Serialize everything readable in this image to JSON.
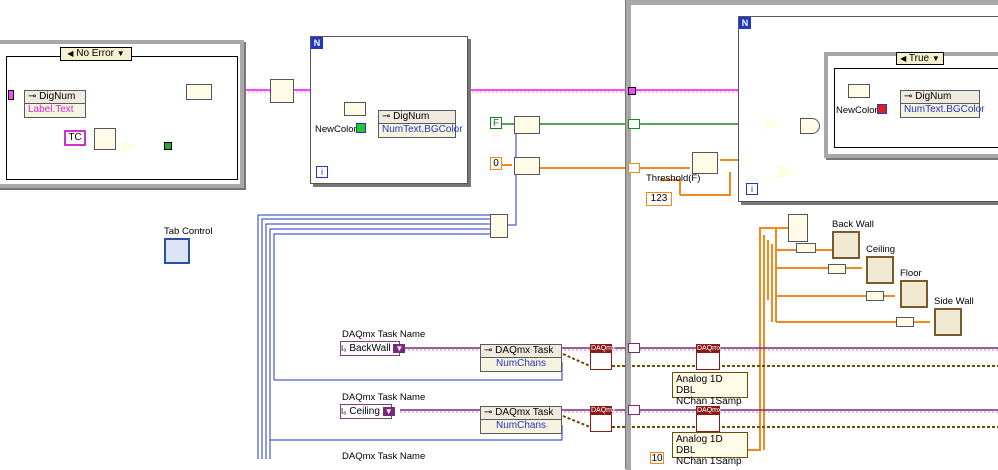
{
  "colors": {
    "string_wire": "#ff44ff",
    "bool_wire": "#1d8a1d",
    "numeric_wire": "#f08a1e",
    "ref_wire": "#1f36c8",
    "task_wire": "#7a2a7a",
    "cluster_wire": "#2b8a8a",
    "structure_border": "#a8a8a8",
    "node_bg": "#f6f3e1",
    "daqmx_badge": "#8b1a1a"
  },
  "error_case": {
    "selector_label": "No Error",
    "property_node": {
      "class": "DigNum",
      "property": "Label.Text"
    },
    "tc_constant": "TC"
  },
  "sequence_frame_1": {
    "n_label": "N",
    "i_label": "i",
    "newcolor_label": "NewColor",
    "property_node": {
      "class": "DigNum",
      "property": "NumText.BGColor"
    }
  },
  "main_loop": {
    "n_label": "N",
    "i_label": "i",
    "true_case_selector": "True",
    "newcolor_label": "NewColor",
    "property_node": {
      "class": "DigNum",
      "property": "NumText.BGColor"
    },
    "bool_constant": "F",
    "zero_constant": "0",
    "ten_constant": "10",
    "threshold_label": "Threshold(F)",
    "threshold_terminal": "123"
  },
  "tab_control_label": "Tab Control",
  "wall_indicators": [
    "Back Wall",
    "Ceiling",
    "Floor",
    "Side Wall"
  ],
  "daqmx_tasks": [
    {
      "caption": "DAQmx Task Name",
      "name": "BackWall",
      "node_class": "DAQmx Task",
      "node_property": "NumChans",
      "poly": "Analog 1D DBL\nNChan 1Samp"
    },
    {
      "caption": "DAQmx Task Name",
      "name": "Ceiling",
      "node_class": "DAQmx Task",
      "node_property": "NumChans",
      "poly": "Analog 1D DBL\nNChan 1Samp"
    },
    {
      "caption": "DAQmx Task Name"
    }
  ],
  "daqmx_badge_text": "DAQmx"
}
